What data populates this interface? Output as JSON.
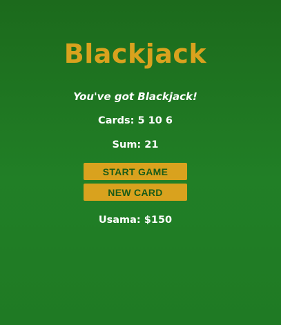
{
  "game": {
    "title": "Blackjack",
    "message": "You've got Blackjack!",
    "cards_text": "Cards: 5 10 6",
    "sum_text": "Sum: 21",
    "player_text": "Usama: $150"
  },
  "buttons": {
    "start_label": "START GAME",
    "new_card_label": "NEW CARD"
  },
  "colors": {
    "background": "#217f26",
    "accent": "#d9a21e",
    "button_text": "#1a5b17"
  }
}
